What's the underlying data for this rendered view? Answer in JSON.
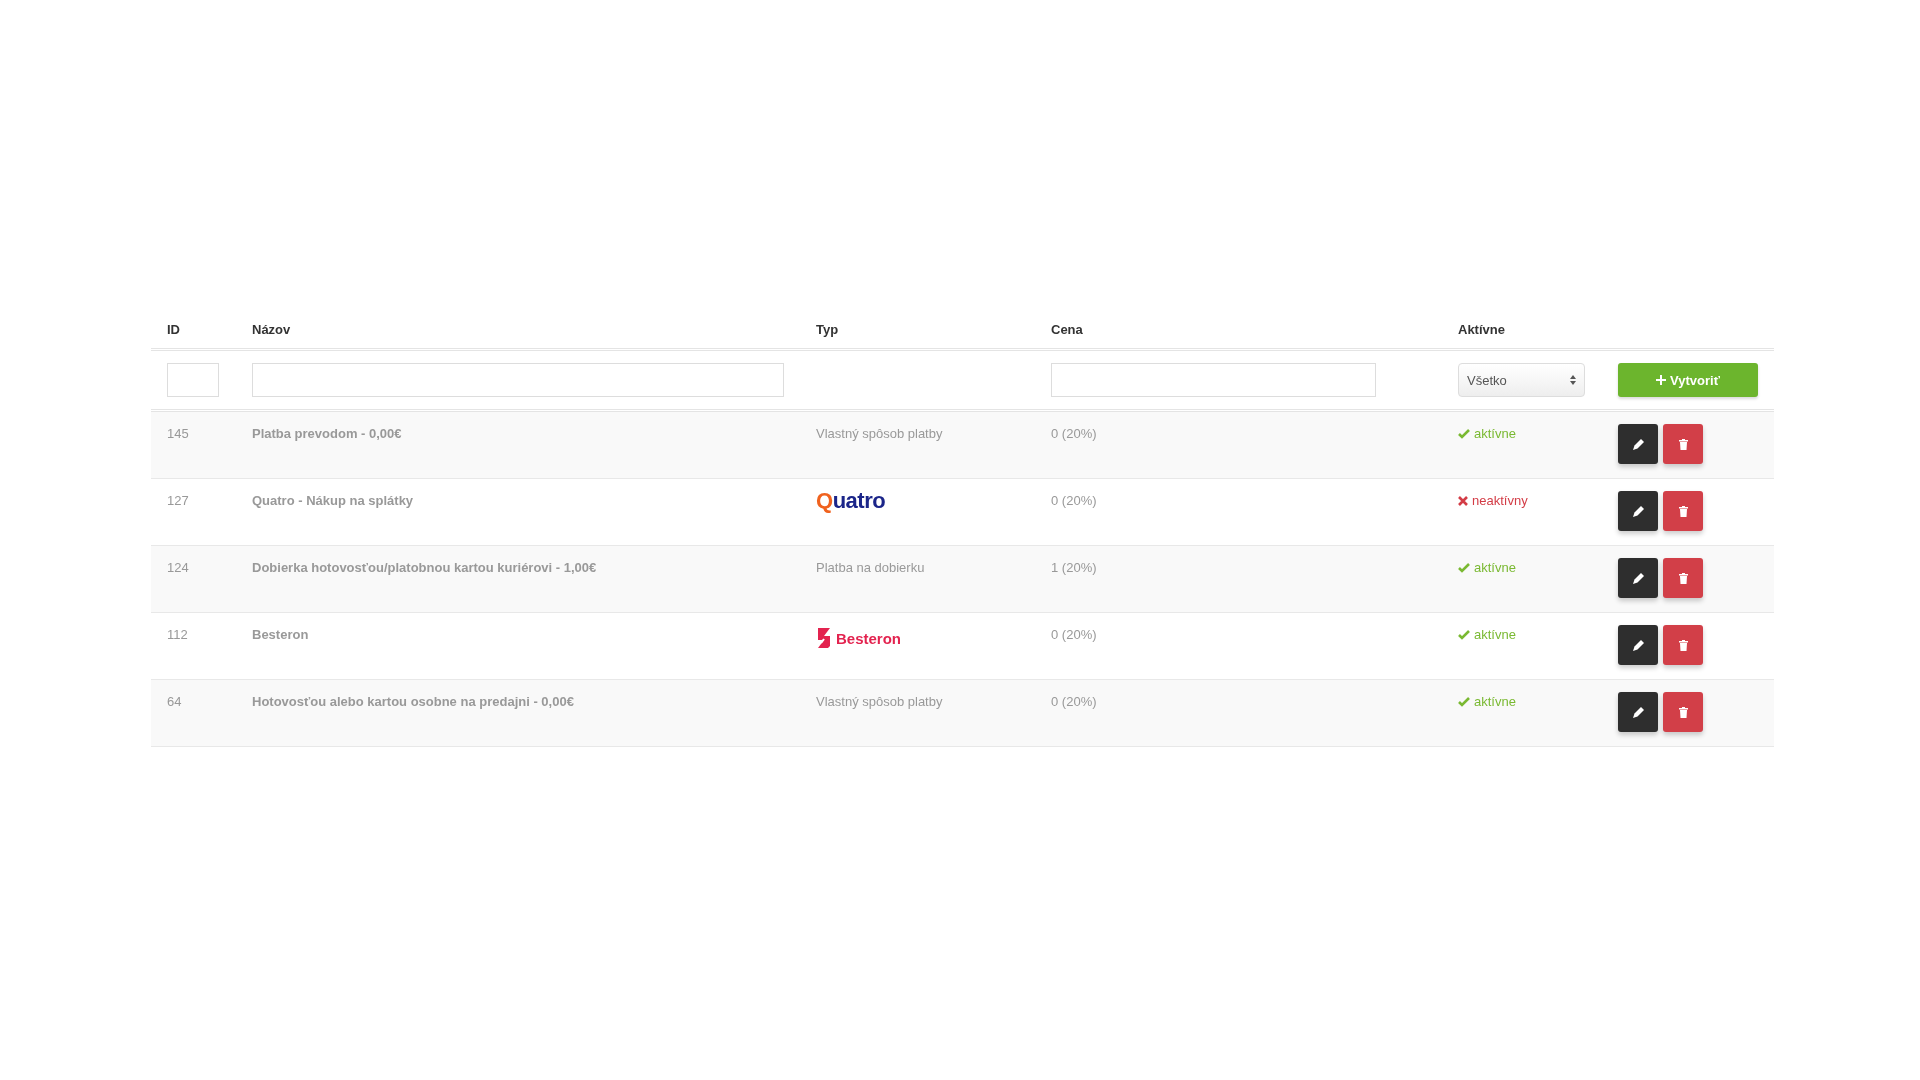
{
  "table": {
    "columns": [
      "ID",
      "Názov",
      "Typ",
      "Cena",
      "Aktívne"
    ],
    "filters": {
      "status_select": "Všetko",
      "create_button": "Vytvoriť"
    },
    "rows": [
      {
        "id": "145",
        "name": "Platba prevodom - 0,00€",
        "type": {
          "kind": "text",
          "text": "Vlastný spôsob platby"
        },
        "price": "0 (20%)",
        "active": true,
        "status": "aktívne"
      },
      {
        "id": "127",
        "name": "Quatro - Nákup na splátky",
        "type": {
          "kind": "quatro",
          "text": "Quatro"
        },
        "price": "0 (20%)",
        "active": false,
        "status": "neaktívny"
      },
      {
        "id": "124",
        "name": "Dobierka hotovosťou/platobnou kartou kuriérovi - 1,00€",
        "type": {
          "kind": "text",
          "text": "Platba na dobierku"
        },
        "price": "1 (20%)",
        "active": true,
        "status": "aktívne"
      },
      {
        "id": "112",
        "name": "Besteron",
        "type": {
          "kind": "besteron",
          "text": "Besteron"
        },
        "price": "0 (20%)",
        "active": true,
        "status": "aktívne"
      },
      {
        "id": "64",
        "name": "Hotovosťou alebo kartou osobne na predajni - 0,00€",
        "type": {
          "kind": "text",
          "text": "Vlastný spôsob platby"
        },
        "price": "0 (20%)",
        "active": true,
        "status": "aktívne"
      }
    ]
  }
}
